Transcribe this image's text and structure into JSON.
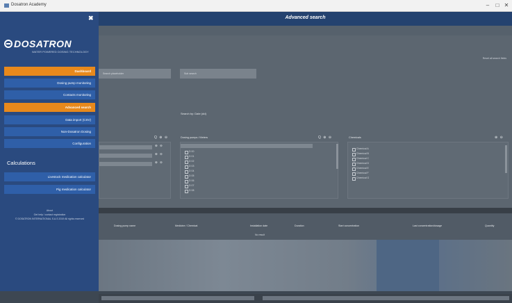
{
  "window": {
    "title": "Dosatron Academy",
    "controls": {
      "minimize": "–",
      "maximize": "□",
      "close": "✕"
    }
  },
  "sidebar": {
    "close_glyph": "✖",
    "logo_word": "DOSATRON",
    "logo_tagline": "WATER POWERED DOSING TECHNOLOGY",
    "nav": [
      {
        "label": "Dashboard",
        "style": "orange"
      },
      {
        "label": "Dosing pump monitoring",
        "style": "blue"
      },
      {
        "label": "Contacts monitoring",
        "style": "blue"
      },
      {
        "label": "Advanced search",
        "style": "orange"
      },
      {
        "label": "Data import (CSV)",
        "style": "blue"
      },
      {
        "label": "Non-Dosatron Dosing",
        "style": "blue"
      },
      {
        "label": "Configuration",
        "style": "blue"
      }
    ],
    "calculations_heading": "Calculations",
    "calc_items": [
      {
        "label": "Livestock medication calculator"
      },
      {
        "label": "Pig medication calculator"
      }
    ],
    "about": {
      "line1": "About",
      "line2": "Get help / contact registration",
      "line3": "© DOSATRON INTERNATIONAL S.A.S 2019 All rights reserved"
    }
  },
  "header": {
    "title": "Advanced search"
  },
  "form": {
    "reset_link": "Reset all search fields",
    "field1_placeholder": "Search placeholder",
    "field2_placeholder": "Sub search",
    "mid_label": "Search by: Date (dd)",
    "panel_left_icons": "Q ⊕ ⊖",
    "panel_mid_title": "Dosing pumps / Meters",
    "panel_mid_icons": "Q ⊕ ⊖",
    "panel_right_title": "Chemicals",
    "panel_right_icons": "⊕ ⊖",
    "left_row_icons": [
      "⊕ ⊖",
      "⊕ ⊖",
      "⊕ ⊖"
    ],
    "mid_items": [
      "D 00",
      "D 01",
      "D 02",
      "D 03",
      "D 04",
      "D 05",
      "D 06",
      "D 07",
      "D 08"
    ],
    "right_items": [
      "Chemical A",
      "Chemical B",
      "Chemical C",
      "Chemical D",
      "Chemical E",
      "Chemical F",
      "Chemical G"
    ]
  },
  "table": {
    "columns": [
      "Dosing pump name",
      "Medicine / Chemical",
      "Installation date",
      "Duration",
      "Start concentration",
      "Last concentration/dosage",
      "Quantity"
    ],
    "empty_text": "No result"
  }
}
